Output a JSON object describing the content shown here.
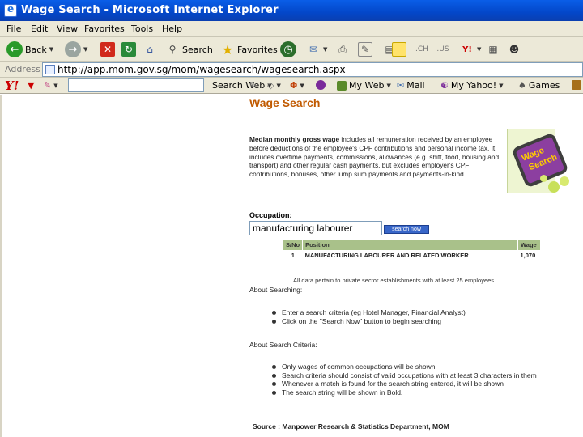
{
  "window": {
    "title": "Wage Search - Microsoft Internet Explorer"
  },
  "menu": [
    "File",
    "Edit",
    "View",
    "Favorites",
    "Tools",
    "Help"
  ],
  "toolbar": {
    "back": "Back",
    "search": "Search",
    "favorites": "Favorites"
  },
  "address": {
    "label": "Address",
    "url": "http://app.mom.gov.sg/mom/wagesearch/wagesearch.aspx"
  },
  "yahoo": {
    "search_web": "Search Web",
    "my_web": "My Web",
    "mail": "Mail",
    "my_yahoo": "My Yahoo!",
    "games": "Games"
  },
  "page": {
    "title": "Wage Search",
    "intro_bold": "Median monthly gross wage",
    "intro_rest": " includes all remuneration received by an employee before deductions of the employee's CPF contributions and personal income tax. It includes overtime payments, commissions, allowances (e.g. shift, food, housing and transport) and other regular cash payments, but excludes employer's CPF contributions, bonuses, other lump sum payments and payments-in-kind.",
    "logo_text": [
      "Wage",
      "Search"
    ],
    "occupation_label": "Occupation:",
    "occupation_value": "manufacturing labourer",
    "search_button": "search now",
    "table": {
      "headers": [
        "S/No",
        "Position",
        "Wage"
      ],
      "rows": [
        [
          "1",
          "MANUFACTURING LABOURER AND RELATED WORKER",
          "1,070"
        ]
      ]
    },
    "note": "All data pertain to private sector establishments with at least 25 employees",
    "about_searching": {
      "heading": "About Searching:",
      "items": [
        "Enter a search criteria (eg Hotel Manager, Financial Analyst)",
        "Click on the \"Search Now\" button to begin searching"
      ]
    },
    "about_criteria": {
      "heading": "About Search Criteria:",
      "items": [
        "Only wages of common occupations will be shown",
        "Search criteria should consist of valid occupations with at least 3 characters in them",
        "Whenever a match is found for the search string entered, it will be shown",
        "The search string will be shown in Bold."
      ]
    },
    "source": "Source : Manpower Research & Statistics Department, MOM"
  }
}
